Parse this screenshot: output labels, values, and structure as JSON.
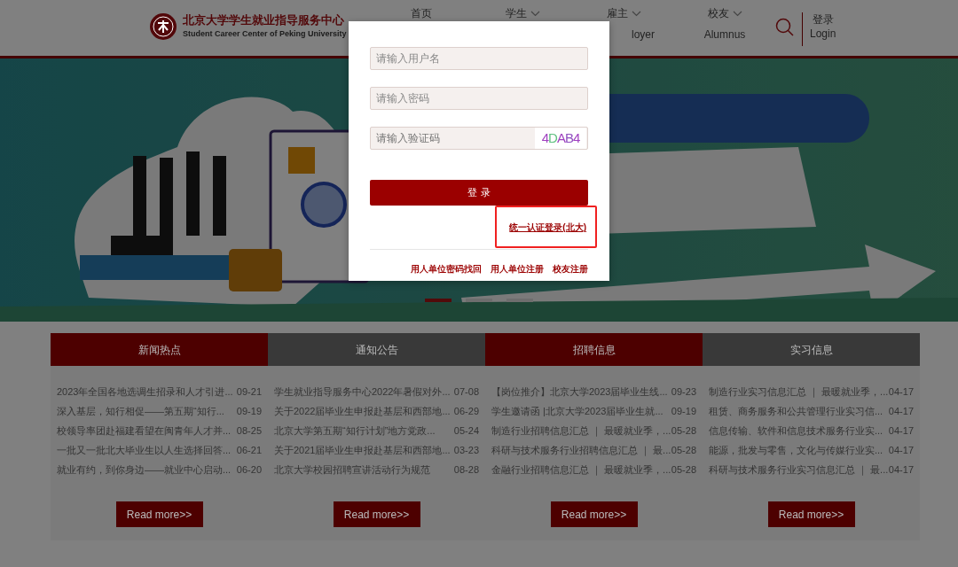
{
  "header": {
    "logo_title": "北京大学学生就业指导服务中心",
    "logo_subtitle": "Student Career Center of Peking University",
    "nav": [
      {
        "label": "首页",
        "dropdown": false
      },
      {
        "label": "学生",
        "dropdown": true
      },
      {
        "label": "雇主",
        "dropdown": true,
        "sublabel": "loyer"
      },
      {
        "label": "校友",
        "dropdown": true,
        "sublabel": "Alumnus"
      }
    ],
    "login": {
      "label": "登录",
      "sublabel": "Login"
    }
  },
  "banner": {
    "kind": "picture",
    "slides": [
      {
        "selected": true
      },
      {
        "selected": false
      },
      {
        "selected": false
      }
    ]
  },
  "sections": [
    {
      "title": "新闻热点",
      "color": "#4d0000",
      "items": [
        {
          "title": "2023年全国各地选调生招录和人才引进...",
          "date": "09-21"
        },
        {
          "title": "深入基层，知行相促——第五期“知行...",
          "date": "09-19"
        },
        {
          "title": "校领导率团赴福建看望在闽青年人才并...",
          "date": "08-25"
        },
        {
          "title": "一批又一批北大毕业生以人生选择回答...",
          "date": "06-21"
        },
        {
          "title": "就业有约，到你身边——就业中心启动...",
          "date": "06-20"
        }
      ],
      "more": "Read more>>"
    },
    {
      "title": "通知公告",
      "color": "#393939",
      "items": [
        {
          "title": "学生就业指导服务中心2022年暑假对外...",
          "date": "07-08"
        },
        {
          "title": "关于2022届毕业生申报赴基层和西部地...",
          "date": "06-29"
        },
        {
          "title": "北京大学第五期“知行计划”地方党政...",
          "date": "05-24"
        },
        {
          "title": "关于2021届毕业生申报赴基层和西部地...",
          "date": "03-23"
        },
        {
          "title": "北京大学校园招聘宣讲活动行为规范",
          "date": "08-28"
        }
      ],
      "more": "Read more>>"
    },
    {
      "title": "招聘信息",
      "color": "#4d0000",
      "items": [
        {
          "title": "【岗位推介】北京大学2023届毕业生线...",
          "date": "09-23"
        },
        {
          "title": "学生邀请函 |北京大学2023届毕业生就...",
          "date": "09-19"
        },
        {
          "title": "制造行业招聘信息汇总 ｜ 最暖就业季，...",
          "date": "05-28"
        },
        {
          "title": "科研与技术服务行业招聘信息汇总 ｜ 最...",
          "date": "05-28"
        },
        {
          "title": "金融行业招聘信息汇总 ｜ 最暖就业季，...",
          "date": "05-28"
        }
      ],
      "more": "Read more>>"
    },
    {
      "title": "实习信息",
      "color": "#393939",
      "items": [
        {
          "title": "制造行业实习信息汇总 ｜ 最暖就业季，...",
          "date": "04-17"
        },
        {
          "title": "租赁、商务服务和公共管理行业实习信...",
          "date": "04-17"
        },
        {
          "title": "信息传输、软件和信息技术服务行业实...",
          "date": "04-17"
        },
        {
          "title": "能源，批发与零售，文化与传媒行业实...",
          "date": "04-17"
        },
        {
          "title": "科研与技术服务行业实习信息汇总 ｜ 最...",
          "date": "04-17"
        }
      ],
      "more": "Read more>>"
    }
  ],
  "login_dialog": {
    "username": {
      "placeholder": "请输入用户名"
    },
    "password": {
      "placeholder": "请输入密码"
    },
    "captcha": {
      "placeholder": "请输入验证码",
      "code": "4DAB4"
    },
    "submit": "登 录",
    "sso_link": {
      "label": "统一认证登录(北大)",
      "highlighted": true
    },
    "links": [
      "用人单位密码找回",
      "用人单位注册",
      "校友注册"
    ]
  }
}
